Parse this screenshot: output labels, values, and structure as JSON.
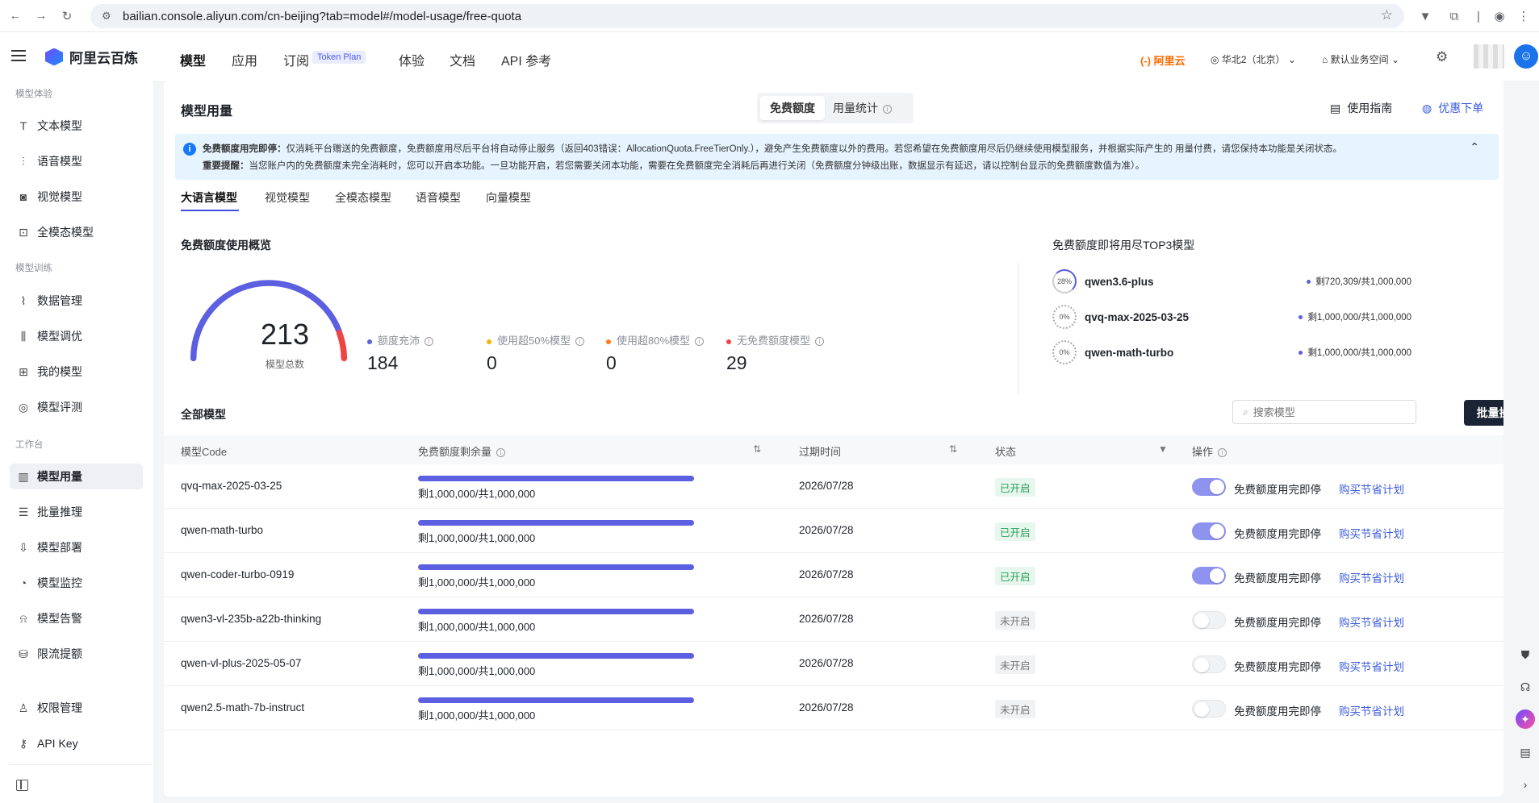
{
  "browser": {
    "url": "bailian.console.aliyun.com/cn-beijing?tab=model#/model-usage/free-quota"
  },
  "topbar": {
    "brand": "阿里云百炼",
    "nav": [
      "模型",
      "应用",
      "订阅",
      "体验",
      "文档",
      "API 参考"
    ],
    "token_plan": "Token Plan",
    "aliyun": "(-) 阿里云",
    "region": "华北2（北京）",
    "workspace": "默认业务空间"
  },
  "sidebar": {
    "groups": [
      "模型体验",
      "模型训练",
      "工作台"
    ],
    "items": [
      "文本模型",
      "语音模型",
      "视觉模型",
      "全模态模型",
      "数据管理",
      "模型调优",
      "我的模型",
      "模型评测",
      "模型用量",
      "批量推理",
      "模型部署",
      "模型监控",
      "模型告警",
      "限流提额",
      "权限管理",
      "API Key"
    ]
  },
  "page": {
    "title": "模型用量",
    "seg_free": "免费额度",
    "seg_stats": "用量统计",
    "guide": "使用指南",
    "coupon": "优惠下单",
    "alert_l1_bold": "免费额度用完即停：",
    "alert_l1": "仅消耗平台赠送的免费额度，免费额度用尽后平台将自动停止服务（返回403错误：AllocationQuota.FreeTierOnly.），避免产生免费额度以外的费用。若您希望在免费额度用尽后仍继续使用模型服务，并根据实际产生的 用量付费，请您保持本功能是关闭状态。",
    "alert_l2_bold": "重要提醒：",
    "alert_l2": "当您账户内的免费额度未完全消耗时，您可以开启本功能。一旦功能开启，若您需要关闭本功能，需要在免费额度完全消耗后再进行关闭（免费额度分钟级出账，数据显示有延迟，请以控制台显示的免费额度数值为准）。",
    "tabs": [
      "大语言模型",
      "视觉模型",
      "全模态模型",
      "语音模型",
      "向量模型"
    ],
    "overview_title": "免费额度使用概览",
    "total": "213",
    "total_label": "模型总数",
    "stats": [
      {
        "label": "额度充沛",
        "value": "184",
        "color": "#5b5fe0"
      },
      {
        "label": "使用超50%模型",
        "value": "0",
        "color": "#f5b301"
      },
      {
        "label": "使用超80%模型",
        "value": "0",
        "color": "#ff7a1a"
      },
      {
        "label": "无免费额度模型",
        "value": "29",
        "color": "#f04343"
      }
    ],
    "top3_title": "免费额度即将用尽TOP3模型",
    "top3": [
      {
        "pct": "28%",
        "name": "qwen3.6-plus",
        "rem": "剩720,309/共1,000,000",
        "used": 0.28
      },
      {
        "pct": "0%",
        "name": "qvq-max-2025-03-25",
        "rem": "剩1,000,000/共1,000,000",
        "used": 0
      },
      {
        "pct": "0%",
        "name": "qwen-math-turbo",
        "rem": "剩1,000,000/共1,000,000",
        "used": 0
      }
    ],
    "all_models": "全部模型",
    "search_placeholder": "搜索模型",
    "bulk_button": "批量操作免费额度用完即停",
    "columns": [
      "模型Code",
      "免费额度剩余量",
      "过期时间",
      "状态",
      "操作"
    ],
    "rows": [
      {
        "code": "qvq-max-2025-03-25",
        "remaining": "剩1,000,000/共1,000,000",
        "remaining_fraction": 1.0,
        "expire": "2026/07/28",
        "status": "已开启",
        "on": true
      },
      {
        "code": "qwen-math-turbo",
        "remaining": "剩1,000,000/共1,000,000",
        "remaining_fraction": 1.0,
        "expire": "2026/07/28",
        "status": "已开启",
        "on": true
      },
      {
        "code": "qwen-coder-turbo-0919",
        "remaining": "剩1,000,000/共1,000,000",
        "remaining_fraction": 1.0,
        "expire": "2026/07/28",
        "status": "已开启",
        "on": true
      },
      {
        "code": "qwen3-vl-235b-a22b-thinking",
        "remaining": "剩1,000,000/共1,000,000",
        "remaining_fraction": 1.0,
        "expire": "2026/07/28",
        "status": "未开启",
        "on": false
      },
      {
        "code": "qwen-vl-plus-2025-05-07",
        "remaining": "剩1,000,000/共1,000,000",
        "remaining_fraction": 1.0,
        "expire": "2026/07/28",
        "status": "未开启",
        "on": false
      },
      {
        "code": "qwen2.5-math-7b-instruct",
        "remaining": "剩1,000,000/共1,000,000",
        "remaining_fraction": 1.0,
        "expire": "2026/07/28",
        "status": "未开启",
        "on": false
      }
    ],
    "toggle_label": "免费额度用完即停",
    "buy_link": "购买节省计划"
  }
}
